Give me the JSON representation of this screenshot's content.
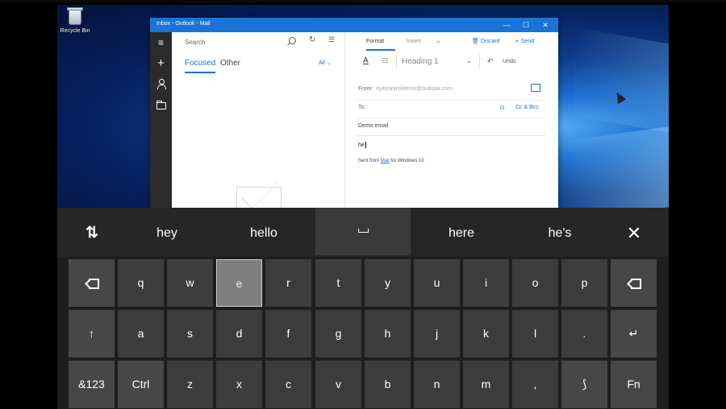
{
  "desktop": {
    "recycle_bin_label": "Recycle Bin"
  },
  "mail": {
    "window_title": "Inbox - Outlook - Mail",
    "window_controls": {
      "minimize": "—",
      "maximize": "☐",
      "close": "✕"
    },
    "rail": {
      "menu": "≡",
      "new": "+"
    },
    "list": {
      "search_placeholder": "Search",
      "tab_focused": "Focused",
      "tab_other": "Other",
      "filter": "All ⌄"
    },
    "toolbar": {
      "tab_format": "Format",
      "tab_insert": "Insert",
      "insert_chevron": "⌄",
      "discard": "Discard",
      "send": "Send",
      "font_icon": "A",
      "style_value": "Heading 1",
      "style_chevron": "⌄",
      "undo": "Undo"
    },
    "compose": {
      "from_label": "From:",
      "from_value": "eyecontroldemo@outlook.com",
      "to_label": "To:",
      "cc_bcc": "Cc & Bcc",
      "subject": "Demo email",
      "body": "he",
      "signature_prefix": "Sent from ",
      "signature_link": "Mail",
      "signature_suffix": " for Windows 10"
    }
  },
  "keyboard": {
    "suggestions": [
      "hey",
      "hello",
      "here",
      "he's"
    ],
    "swap_icon": "⇅",
    "close_icon": "✕",
    "row1": [
      "q",
      "w",
      "e",
      "r",
      "t",
      "y",
      "u",
      "i",
      "o",
      "p"
    ],
    "row2": [
      "a",
      "s",
      "d",
      "f",
      "g",
      "h",
      "j",
      "k",
      "l",
      "."
    ],
    "row3": [
      "z",
      "x",
      "c",
      "v",
      "b",
      "n",
      "m",
      ","
    ],
    "shift": "↑",
    "enter": "↵",
    "numbers": "&123",
    "ctrl": "Ctrl",
    "swipe": "⟆",
    "fn": "Fn",
    "highlighted_key": "e"
  },
  "colors": {
    "accent": "#1a73d6",
    "keyboard_bg": "#1e1e1e",
    "key_bg": "#3c3c3c",
    "key_highlight": "#7f7f7f"
  }
}
